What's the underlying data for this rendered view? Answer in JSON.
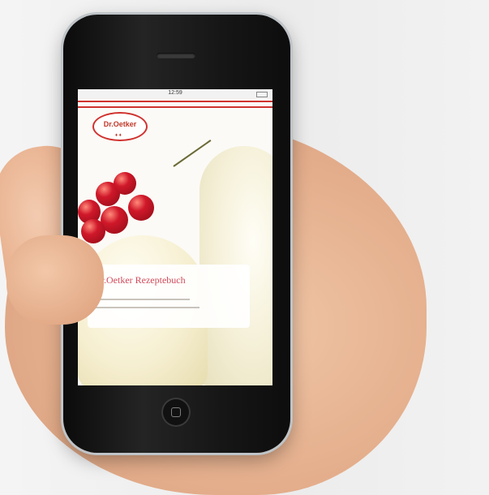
{
  "status_bar": {
    "time": "12:59"
  },
  "app": {
    "brand_logo_text": "Dr.Oetker",
    "card_title": "Dr.Oetker Rezeptebuch"
  },
  "colors": {
    "brand_red": "#d0322f",
    "card_title": "#d04a5a",
    "phone_body": "#161616"
  },
  "icons": [
    "home-button-icon",
    "battery-icon",
    "cherry-image"
  ]
}
